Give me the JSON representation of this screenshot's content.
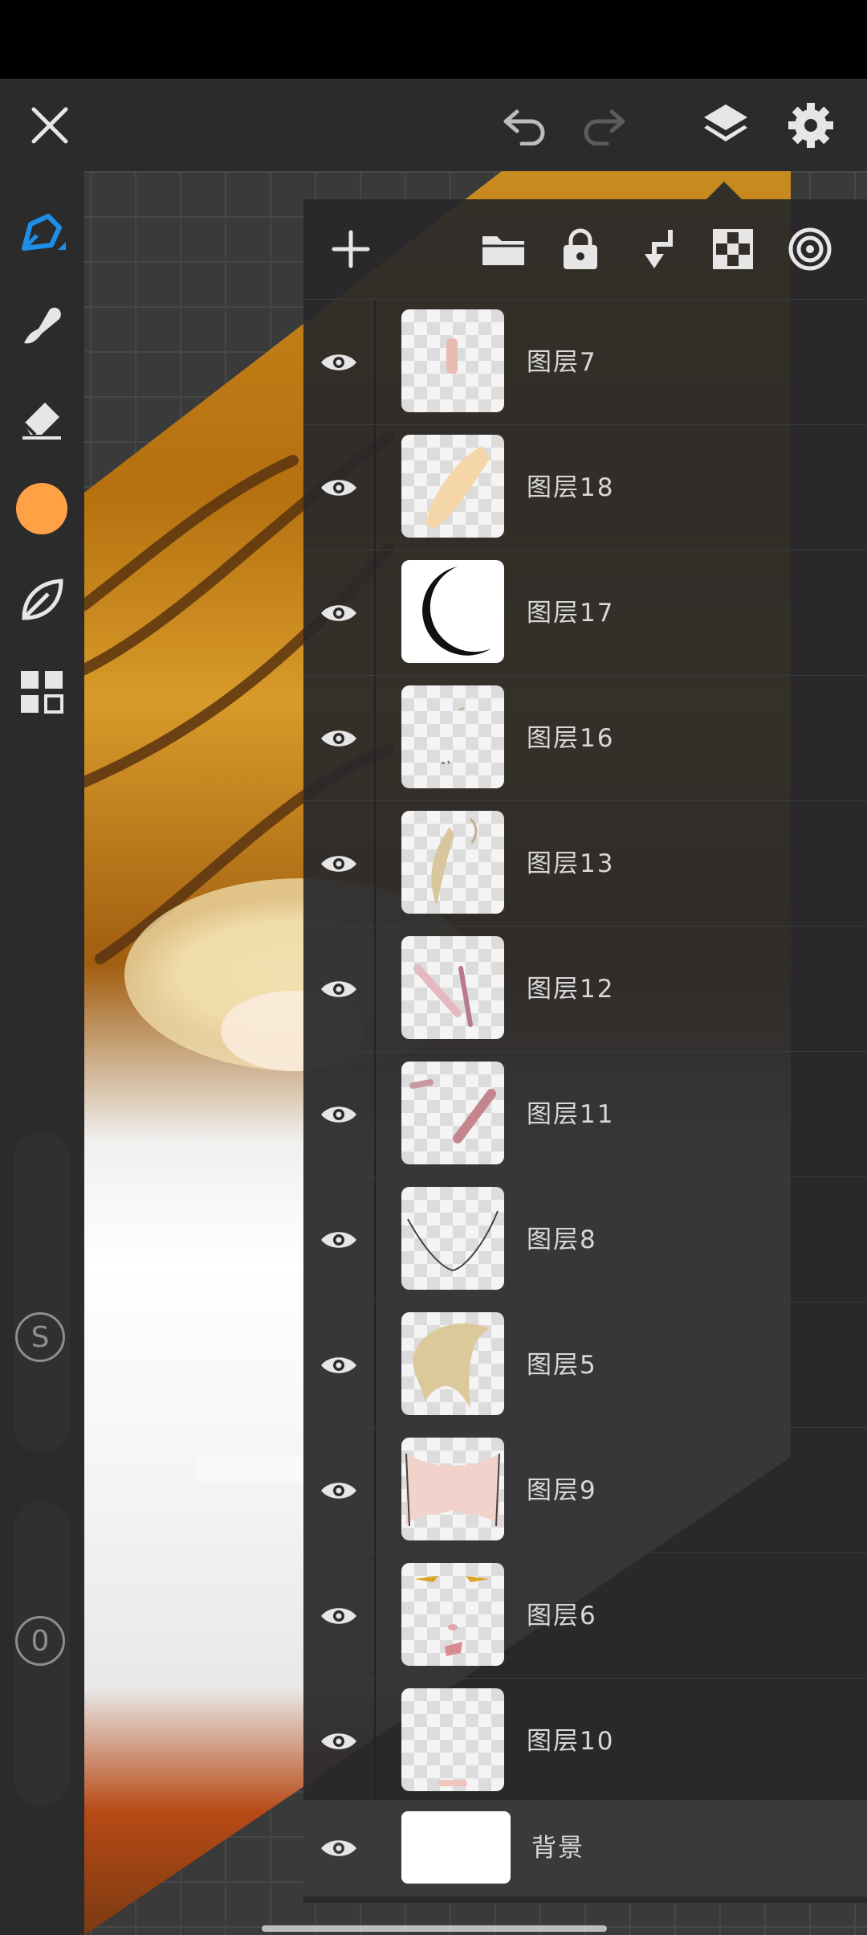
{
  "app": {
    "toolbar": {
      "close_icon": "close-icon",
      "undo_icon": "undo-icon",
      "redo_icon": "redo-icon",
      "layers_icon": "layers-icon",
      "settings_icon": "gear-icon"
    },
    "sidebar": {
      "tools": [
        "pen-tool-icon",
        "smudge-tool-icon",
        "eraser-tool-icon",
        "color-swatch",
        "leaf-brush-icon",
        "grid-menu-icon"
      ],
      "current_color": "#ffa145",
      "size_badge": "S",
      "opacity_badge": "0"
    },
    "layers_panel": {
      "toolbar_icons": [
        "add-layer-icon",
        "folder-icon",
        "lock-icon",
        "merge-down-icon",
        "checkerboard-icon",
        "blend-target-icon"
      ],
      "layers": [
        {
          "name": "图层7",
          "visible": true
        },
        {
          "name": "图层18",
          "visible": true
        },
        {
          "name": "图层17",
          "visible": true
        },
        {
          "name": "图层16",
          "visible": true
        },
        {
          "name": "图层13",
          "visible": true
        },
        {
          "name": "图层12",
          "visible": true
        },
        {
          "name": "图层11",
          "visible": true
        },
        {
          "name": "图层8",
          "visible": true
        },
        {
          "name": "图层5",
          "visible": true
        },
        {
          "name": "图层9",
          "visible": true
        },
        {
          "name": "图层6",
          "visible": true
        },
        {
          "name": "图层10",
          "visible": true
        }
      ],
      "background_layer": {
        "name": "背景",
        "visible": true
      }
    },
    "colors": {
      "accent_blue": "#1e8fe8",
      "panel_bg": "#2b2b2c",
      "icon_light": "#e6e6e6"
    }
  }
}
